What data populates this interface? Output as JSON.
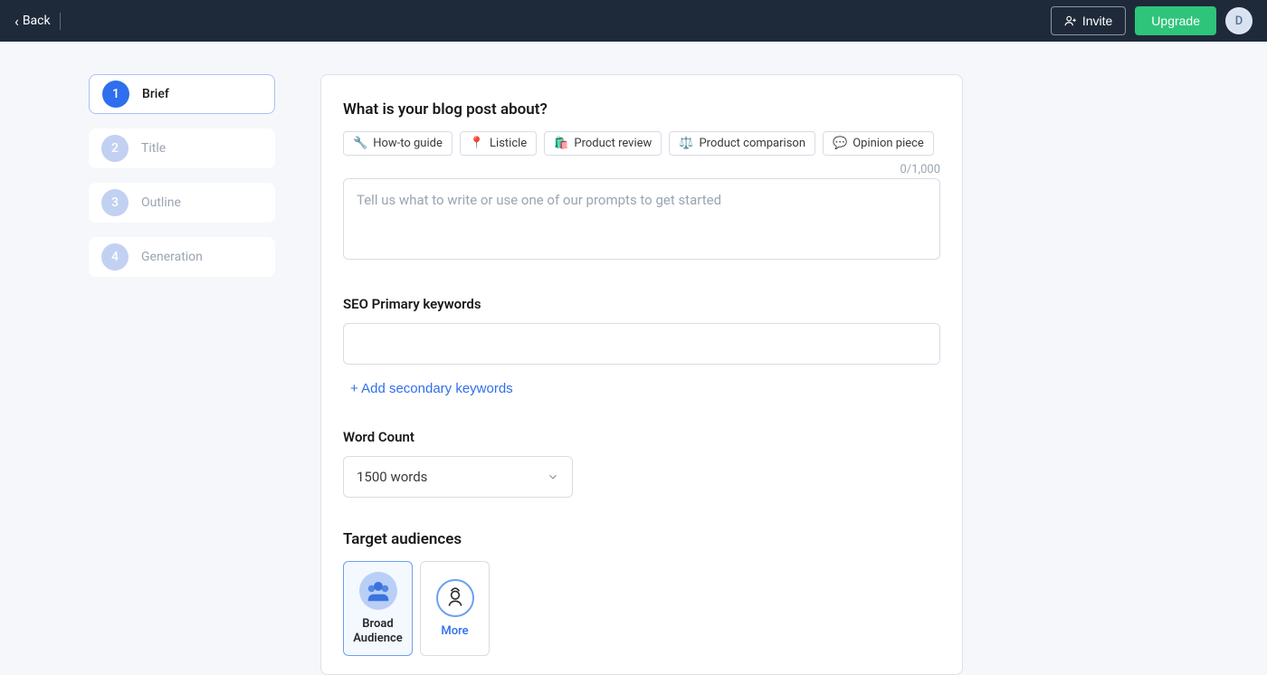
{
  "topbar": {
    "back_label": "Back",
    "invite_label": "Invite",
    "upgrade_label": "Upgrade",
    "avatar_initial": "D"
  },
  "steps": [
    {
      "num": "1",
      "label": "Brief"
    },
    {
      "num": "2",
      "label": "Title"
    },
    {
      "num": "3",
      "label": "Outline"
    },
    {
      "num": "4",
      "label": "Generation"
    }
  ],
  "brief": {
    "heading": "What is your blog post about?",
    "chips": [
      {
        "emoji": "🔧",
        "label": "How-to guide"
      },
      {
        "emoji": "📍",
        "label": "Listicle"
      },
      {
        "emoji": "🛍️",
        "label": "Product review"
      },
      {
        "emoji": "⚖️",
        "label": "Product comparison"
      },
      {
        "emoji": "💬",
        "label": "Opinion piece"
      }
    ],
    "char_counter": "0/1,000",
    "placeholder": "Tell us what to write or use one of our prompts to get started"
  },
  "seo": {
    "label": "SEO Primary keywords",
    "add_secondary_label": "+ Add secondary keywords"
  },
  "wordcount": {
    "label": "Word Count",
    "selected": "1500 words"
  },
  "audience": {
    "label": "Target audiences",
    "broad_label": "Broad Audience",
    "more_label": "More"
  }
}
